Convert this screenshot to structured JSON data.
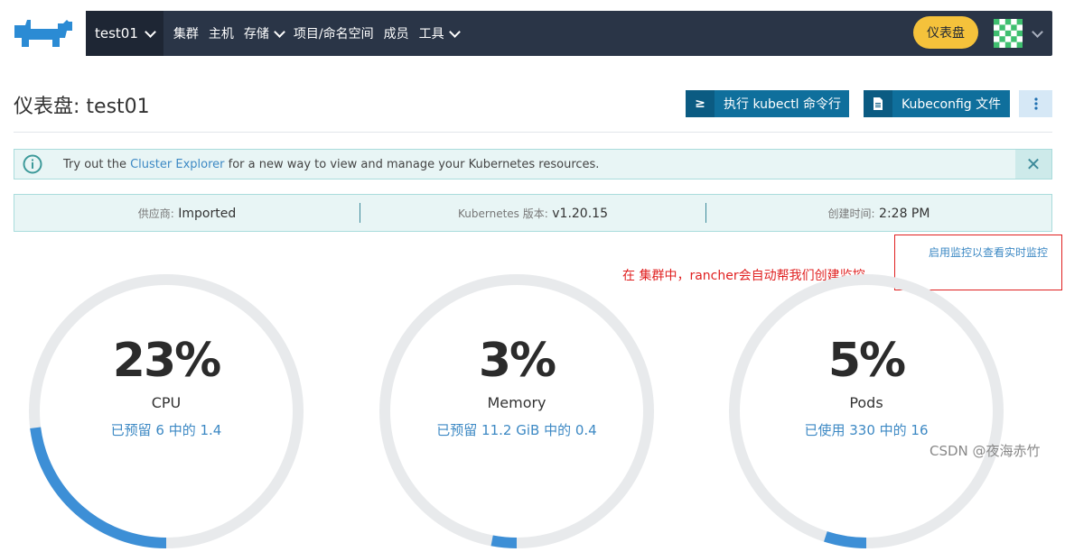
{
  "topnav": {
    "cluster": "test01",
    "items": [
      {
        "label": "集群",
        "dropdown": false
      },
      {
        "label": "主机",
        "dropdown": false
      },
      {
        "label": "存储",
        "dropdown": true
      },
      {
        "label": "项目/命名空间",
        "dropdown": false
      },
      {
        "label": "成员",
        "dropdown": false
      },
      {
        "label": "工具",
        "dropdown": true
      }
    ],
    "dashboard_button": "仪表盘"
  },
  "header": {
    "title": "仪表盘: test01",
    "kubectl_button": "执行 kubectl 命令行",
    "kubectl_icon": "≥",
    "kubeconfig_button": "Kubeconfig 文件"
  },
  "banner": {
    "prefix": "Try out the ",
    "link": "Cluster Explorer",
    "suffix": " for a new way to view and manage your Kubernetes resources."
  },
  "info": {
    "provider_label": "供应商:",
    "provider_value": "Imported",
    "version_label": "Kubernetes 版本:",
    "version_value": "v1.20.15",
    "created_label": "创建时间:",
    "created_value": "2:28 PM"
  },
  "monitoring_link": "启用监控以查看实时监控",
  "annotation": "在 集群中，rancher会自动帮我们创建监控",
  "gauges": [
    {
      "pct_text": "23%",
      "label": "CPU",
      "sub": "已预留 6 中的 1.4",
      "fraction": 0.23
    },
    {
      "pct_text": "3%",
      "label": "Memory",
      "sub": "已预留 11.2 GiB 中的 0.4",
      "fraction": 0.03
    },
    {
      "pct_text": "5%",
      "label": "Pods",
      "sub": "已使用 330 中的 16",
      "fraction": 0.05
    }
  ],
  "watermark": "CSDN @夜海赤竹",
  "colors": {
    "nav_bg": "#2a3547",
    "accent_yellow": "#f5c23b",
    "primary_blue": "#0f6f9c",
    "gauge_track": "#e8eaec",
    "gauge_fill": "#3d8fd6",
    "annotation_red": "#e02020"
  }
}
